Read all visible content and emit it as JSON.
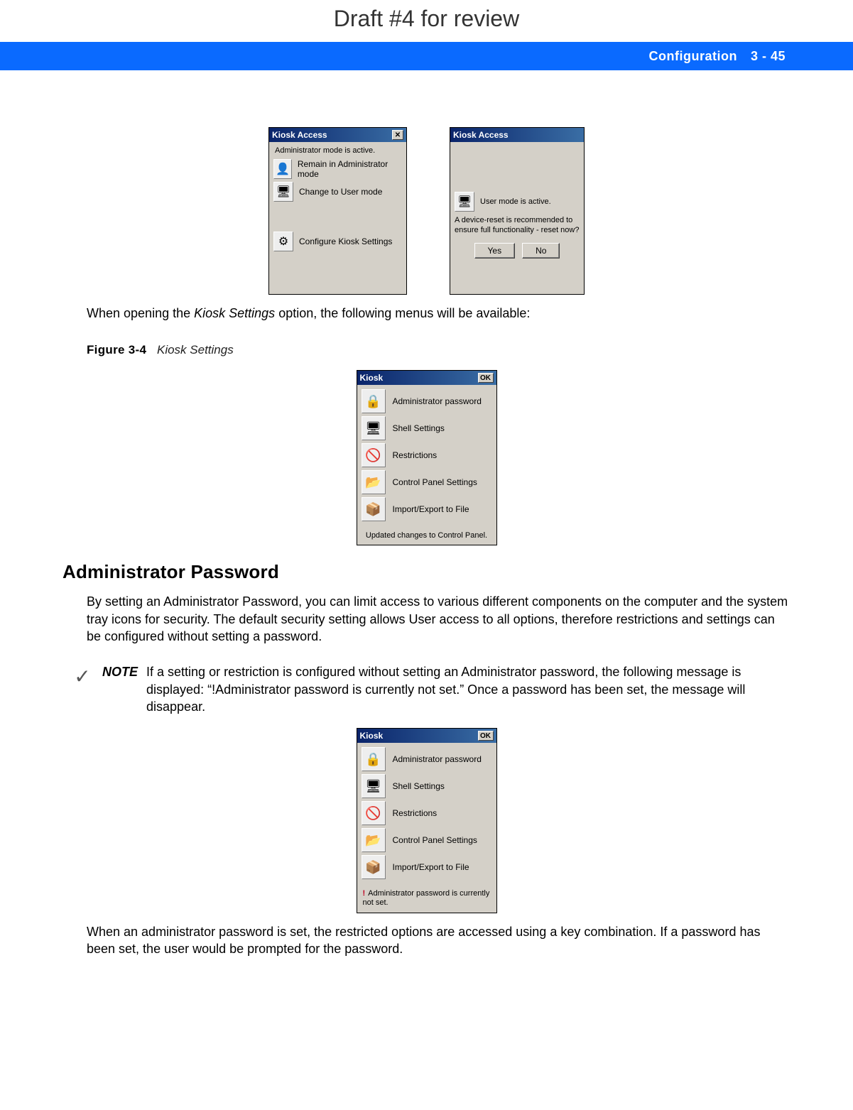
{
  "draft_title": "Draft #4 for review",
  "header": {
    "section": "Configuration",
    "page": "3 - 45"
  },
  "panels": {
    "admin_access": {
      "title": "Kiosk Access",
      "status": "Administrator mode is active.",
      "items": [
        "Remain in Administrator mode",
        "Change to User mode",
        "Configure Kiosk Settings"
      ]
    },
    "user_access": {
      "title": "Kiosk Access",
      "status": "User mode is active.",
      "message": "A device-reset is recommended to ensure full functionality - reset now?",
      "yes": "Yes",
      "no": "No"
    }
  },
  "intro_para_pre": "When opening the ",
  "intro_para_em": "Kiosk Settings",
  "intro_para_post": " option, the following menus will be available:",
  "figure": {
    "label": "Figure 3-4",
    "caption": "Kiosk Settings"
  },
  "kiosk_menu": {
    "title": "Kiosk",
    "ok": "OK",
    "items": [
      "Administrator password",
      "Shell Settings",
      "Restrictions",
      "Control Panel Settings",
      "Import/Export to File"
    ],
    "footer_ok": "Updated changes to Control Panel.",
    "footer_warn": "Administrator password is currently not set."
  },
  "section_heading": "Administrator Password",
  "section_para": "By setting an Administrator Password, you can limit access to various different components on the computer and the system tray icons for security. The default security setting allows User access to all options, therefore restrictions and settings can be configured without setting a password.",
  "note": {
    "label": "NOTE",
    "text": "If a setting or restriction is configured without setting an Administrator password, the following message is displayed: “!Administrator password is currently not set.” Once a password has been set, the message will disappear."
  },
  "closing_para": "When an administrator password is set, the restricted options are accessed using a key combination. If a password has been set, the user would be prompted for the password.",
  "icons": {
    "close": "✕",
    "lock": "🔒",
    "shell": "🖥",
    "restrict": "🚫",
    "cpl": "📂",
    "import": "📦",
    "person": "👤",
    "kiosk": "🖥",
    "gear": "⚙",
    "check": "✓",
    "warn": "!"
  }
}
